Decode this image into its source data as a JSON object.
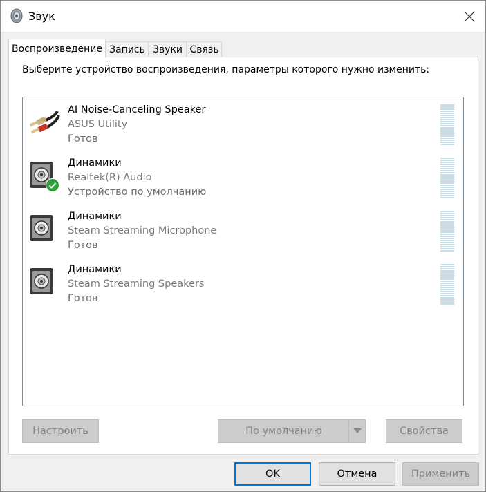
{
  "window": {
    "title": "Звук",
    "close_label": "✕"
  },
  "tabs": [
    {
      "label": "Воспроизведение",
      "active": true
    },
    {
      "label": "Запись",
      "active": false
    },
    {
      "label": "Звуки",
      "active": false
    },
    {
      "label": "Связь",
      "active": false
    }
  ],
  "instruction": "Выберите устройство воспроизведения, параметры которого нужно изменить:",
  "devices": [
    {
      "name": "AI Noise-Canceling Speaker",
      "driver": "ASUS Utility",
      "status": "Готов",
      "icon": "rca-cable-icon",
      "is_default": false
    },
    {
      "name": "Динамики",
      "driver": "Realtek(R) Audio",
      "status": "Устройство по умолчанию",
      "icon": "speaker-icon",
      "is_default": true
    },
    {
      "name": "Динамики",
      "driver": "Steam Streaming Microphone",
      "status": "Готов",
      "icon": "speaker-icon",
      "is_default": false
    },
    {
      "name": "Динамики",
      "driver": "Steam Streaming Speakers",
      "status": "Готов",
      "icon": "speaker-icon",
      "is_default": false
    }
  ],
  "buttons": {
    "configure": "Настроить",
    "set_default": "По умолчанию",
    "properties": "Свойства",
    "ok": "OK",
    "cancel": "Отмена",
    "apply": "Применить"
  },
  "colors": {
    "accent": "#0078d7",
    "meter": "#c7dde8",
    "default_check": "#2e9e3b"
  }
}
